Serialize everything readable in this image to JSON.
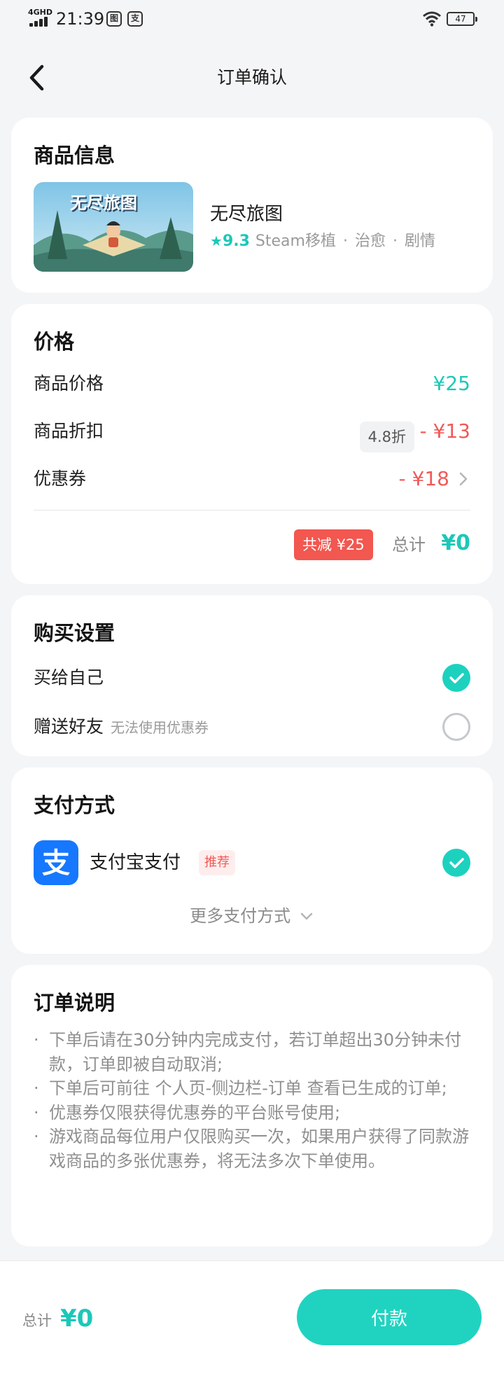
{
  "status_bar": {
    "network": "4GHD",
    "time": "21:39",
    "app_icon_1": "图",
    "app_icon_2": "支",
    "battery": "47"
  },
  "header": {
    "title": "订单确认"
  },
  "product": {
    "section_title": "商品信息",
    "cover_text": "无尽旅图",
    "name": "无尽旅图",
    "rating": "9.3",
    "tags": [
      "Steam移植",
      "治愈",
      "剧情"
    ]
  },
  "price": {
    "section_title": "价格",
    "item_price_label": "商品价格",
    "item_price": "¥25",
    "discount_label": "商品折扣",
    "discount_tag": "4.8折",
    "discount_amount": "- ¥13",
    "coupon_label": "优惠券",
    "coupon_amount": "- ¥18",
    "reduce_badge": "共减 ¥25",
    "total_label": "总计",
    "total": "¥0"
  },
  "purchase": {
    "section_title": "购买设置",
    "self_label": "买给自己",
    "gift_label": "赠送好友",
    "gift_note": "无法使用优惠券"
  },
  "payment": {
    "section_title": "支付方式",
    "method": "支付宝支付",
    "recommend_tag": "推荐",
    "more": "更多支付方式"
  },
  "notes": {
    "section_title": "订单说明",
    "items": [
      "下单后请在30分钟内完成支付，若订单超出30分钟未付款，订单即被自动取消;",
      "下单后可前往 个人页-侧边栏-订单 查看已生成的订单;",
      "优惠券仅限获得优惠券的平台账号使用;",
      "游戏商品每位用户仅限购买一次，如果用户获得了同款游戏商品的多张优惠券，将无法多次下单使用。"
    ]
  },
  "bottom": {
    "total_label": "总计",
    "total": "¥0",
    "pay_button": "付款"
  },
  "colors": {
    "accent": "#1cc8b8",
    "danger": "#f05a57",
    "alipay": "#1678ff"
  }
}
